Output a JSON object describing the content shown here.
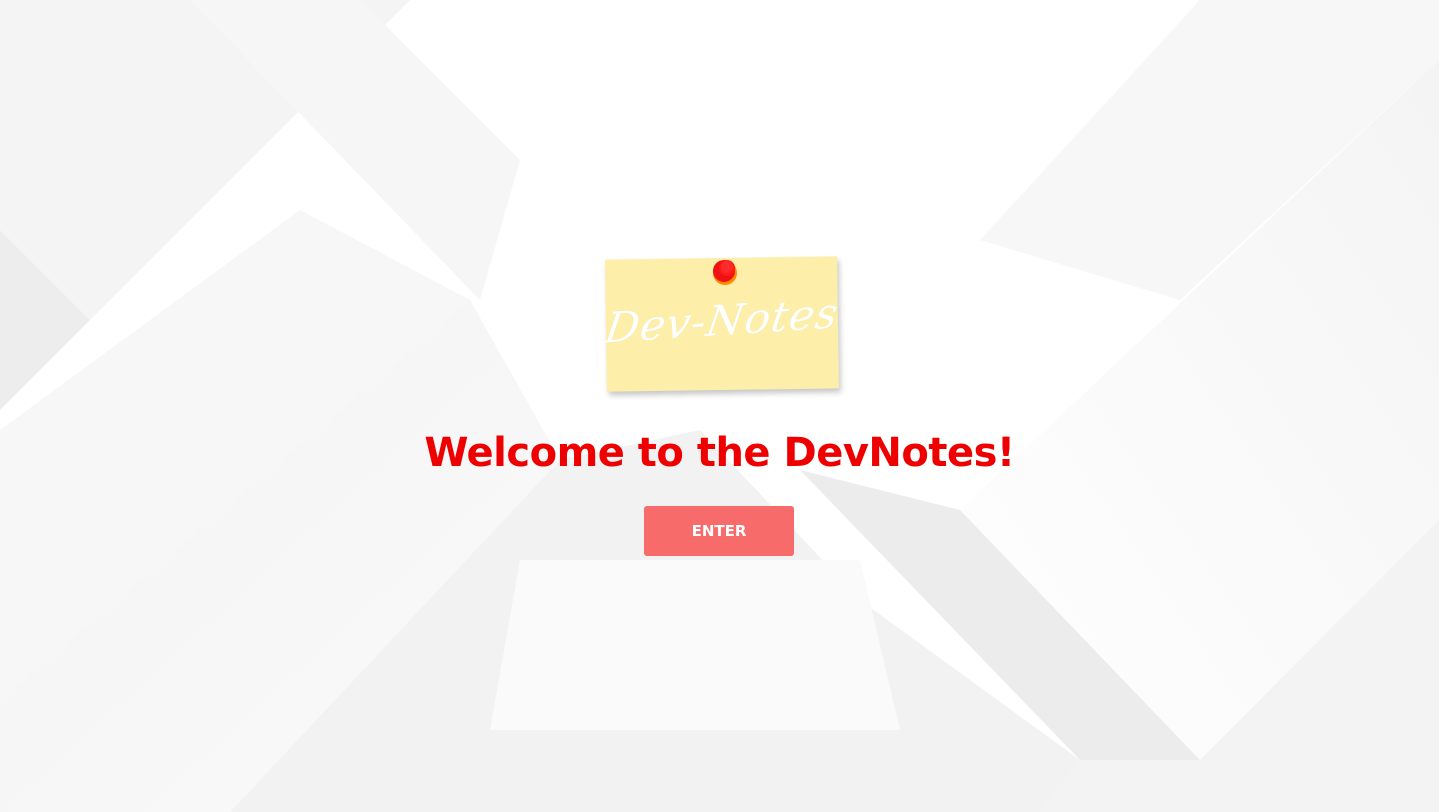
{
  "logo": {
    "text": "Dev-Notes",
    "note_color": "#fdeeaa",
    "pin_color": "#ee1111"
  },
  "hero": {
    "title": "Welcome to the DevNotes!",
    "title_color": "#ee0000"
  },
  "enter_button": {
    "label": "ENTER",
    "color": "#f76b6b"
  }
}
